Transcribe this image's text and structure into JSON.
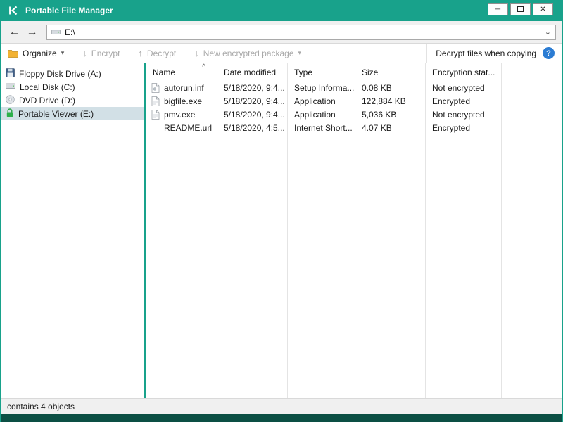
{
  "window": {
    "title": "Portable File Manager",
    "controls": {
      "minimize": "─",
      "close": "✕"
    }
  },
  "icons": {
    "back": "←",
    "forward": "→",
    "address_chevron": "⌄",
    "organize_caret": "▾",
    "package_caret": "▾",
    "encrypt_arrow": "↓",
    "decrypt_arrow": "↑",
    "package_arrow": "↓",
    "sort_ascending": "^",
    "help": "?"
  },
  "nav": {
    "address": "E:\\"
  },
  "toolbar": {
    "organize_label": "Organize",
    "encrypt_label": "Encrypt",
    "decrypt_label": "Decrypt",
    "new_package_label": "New encrypted package",
    "decrypt_when_copying_label": "Decrypt files when copying"
  },
  "sidebar": {
    "items": [
      {
        "label": "Floppy Disk Drive (A:)"
      },
      {
        "label": "Local Disk (C:)"
      },
      {
        "label": "DVD Drive (D:)"
      },
      {
        "label": "Portable Viewer (E:)"
      }
    ]
  },
  "filelist": {
    "columns": [
      "Name",
      "Date modified",
      "Type",
      "Size",
      "Encryption stat..."
    ],
    "rows": [
      {
        "name": "autorun.inf",
        "date_modified": "5/18/2020, 9:4...",
        "type": "Setup Informa...",
        "size": "0.08 KB",
        "encryption_status": "Not encrypted"
      },
      {
        "name": "bigfile.exe",
        "date_modified": "5/18/2020, 9:4...",
        "type": "Application",
        "size": "122,884 KB",
        "encryption_status": "Encrypted"
      },
      {
        "name": "pmv.exe",
        "date_modified": "5/18/2020, 9:4...",
        "type": "Application",
        "size": "5,036 KB",
        "encryption_status": "Not encrypted"
      },
      {
        "name": "README.url",
        "date_modified": "5/18/2020, 4:5...",
        "type": "Internet Short...",
        "size": "4.07 KB",
        "encryption_status": "Encrypted"
      }
    ]
  },
  "statusbar": {
    "text": "contains 4 objects"
  },
  "colors": {
    "titlebar_teal": "#18a28b",
    "bottom_teal": "#0c4f44",
    "selection": "#d2e0e6",
    "help_blue": "#2b7cd3"
  }
}
